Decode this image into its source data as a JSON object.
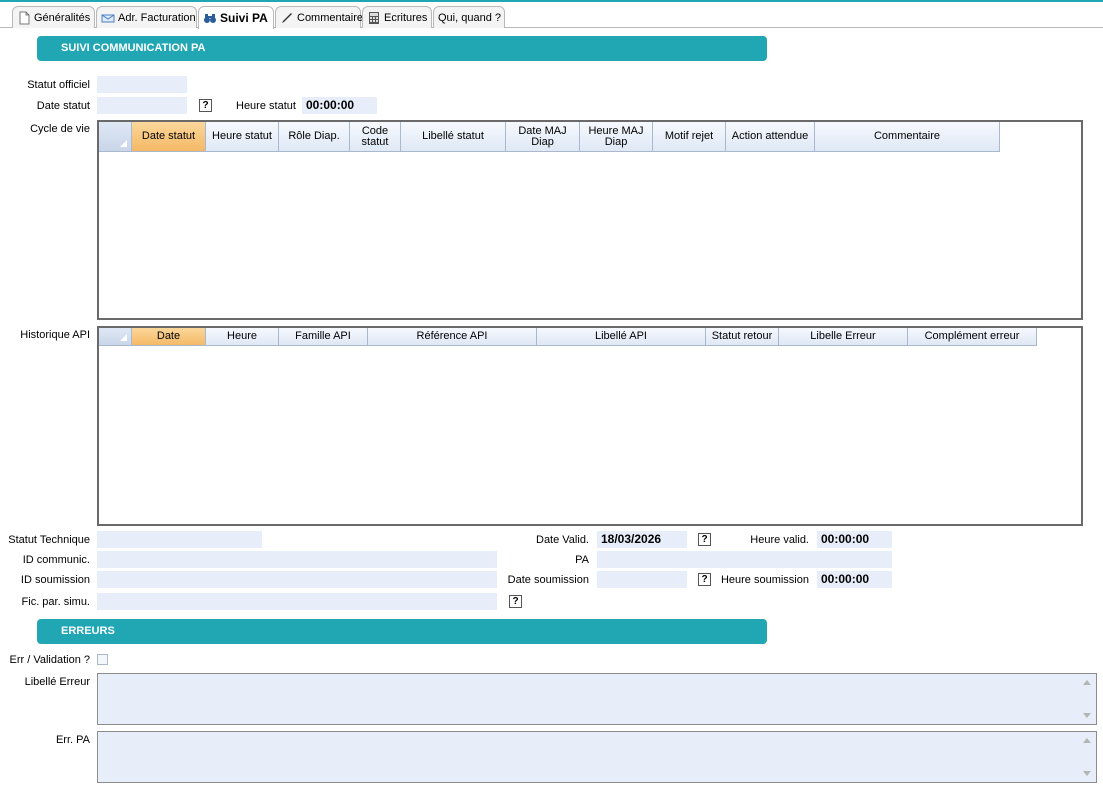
{
  "tabs": [
    {
      "label": "Généralités",
      "icon": "page-icon",
      "active": false
    },
    {
      "label": "Adr. Facturation",
      "icon": "envelope-icon",
      "active": false
    },
    {
      "label": "Suivi PA",
      "icon": "binoculars-icon",
      "active": true
    },
    {
      "label": "Commentaire",
      "icon": "pen-icon",
      "active": false
    },
    {
      "label": "Ecritures",
      "icon": "calculator-icon",
      "active": false
    },
    {
      "label": "Qui, quand ?",
      "icon": "",
      "active": false
    }
  ],
  "suivi": {
    "title": "SUIVI COMMUNICATION PA",
    "statut_officiel_label": "Statut officiel",
    "statut_officiel_value": "",
    "date_statut_label": "Date statut",
    "date_statut_value": "",
    "heure_statut_label": "Heure statut",
    "heure_statut_value": "00:00:00",
    "help_label": "?",
    "cycle_label": "Cycle de vie",
    "cycle_columns": [
      "Date statut",
      "Heure statut",
      "Rôle Diap.",
      "Code statut",
      "Libellé statut",
      "Date MAJ Diap",
      "Heure MAJ Diap",
      "Motif rejet",
      "Action attendue",
      "Commentaire"
    ],
    "historique_label": "Historique API",
    "historique_columns": [
      "Date",
      "Heure",
      "Famille API",
      "Référence API",
      "Libellé API",
      "Statut retour",
      "Libelle Erreur",
      "Complément erreur"
    ],
    "statut_technique_label": "Statut Technique",
    "statut_technique_value": "",
    "id_communic_label": "ID communic.",
    "id_communic_value": "",
    "id_soumission_label": "ID soumission",
    "id_soumission_value": "",
    "fic_par_simu_label": "Fic. par. simu.",
    "fic_par_simu_value": "",
    "date_valid_label": "Date Valid.",
    "date_valid_value": "18/03/2026",
    "heure_valid_label": "Heure valid.",
    "heure_valid_value": "00:00:00",
    "pa_label": "PA",
    "pa_value": "",
    "date_soumission_label": "Date soumission",
    "date_soumission_value": "",
    "heure_soumission_label": "Heure soumission",
    "heure_soumission_value": "00:00:00"
  },
  "erreurs": {
    "title": "ERREURS",
    "err_validation_label": "Err / Validation ?",
    "err_validation_checked": false,
    "libelle_erreur_label": "Libellé Erreur",
    "libelle_erreur_value": "",
    "err_pa_label": "Err. PA",
    "err_pa_value": ""
  },
  "colors": {
    "accent": "#21a6b3",
    "field_bg": "#e8eef9",
    "sorted_header": "#f4b966"
  }
}
